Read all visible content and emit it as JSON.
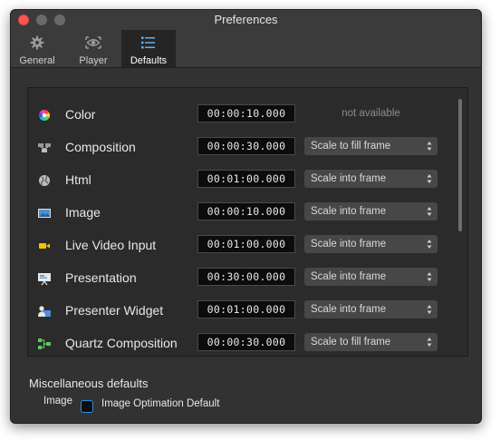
{
  "window": {
    "title": "Preferences"
  },
  "tabs": [
    {
      "label": "General",
      "icon": "gear-icon"
    },
    {
      "label": "Player",
      "icon": "eye-icon"
    },
    {
      "label": "Defaults",
      "icon": "list-icon",
      "active": true
    }
  ],
  "defaults": [
    {
      "name": "Color",
      "icon": "color-wheel-icon",
      "duration": "00:00:10.000",
      "scaling": "not available"
    },
    {
      "name": "Composition",
      "icon": "composition-icon",
      "duration": "00:00:30.000",
      "scaling": "Scale to fill frame"
    },
    {
      "name": "Html",
      "icon": "globe-icon",
      "duration": "00:01:00.000",
      "scaling": "Scale into frame"
    },
    {
      "name": "Image",
      "icon": "image-icon",
      "duration": "00:00:10.000",
      "scaling": "Scale into frame"
    },
    {
      "name": "Live Video Input",
      "icon": "camera-icon",
      "duration": "00:01:00.000",
      "scaling": "Scale into frame"
    },
    {
      "name": "Presentation",
      "icon": "presentation-icon",
      "duration": "00:30:00.000",
      "scaling": "Scale into frame"
    },
    {
      "name": "Presenter Widget",
      "icon": "presenter-icon",
      "duration": "00:01:00.000",
      "scaling": "Scale into frame"
    },
    {
      "name": "Quartz Composition",
      "icon": "quartz-icon",
      "duration": "00:00:30.000",
      "scaling": "Scale to fill frame"
    }
  ],
  "misc": {
    "heading": "Miscellaneous defaults",
    "label": "Image",
    "checkbox_label": "Image Optimation Default"
  },
  "colors": {
    "accent": "#2d8ee6",
    "window_bg": "#323232",
    "panel_bg": "#2b2b2b"
  }
}
